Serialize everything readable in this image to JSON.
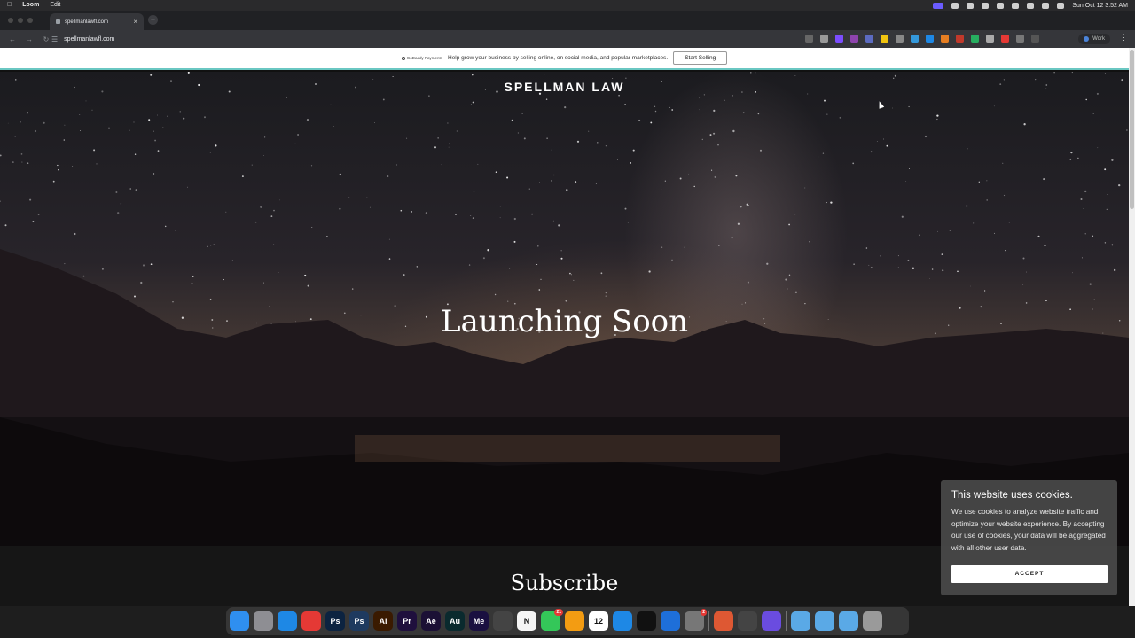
{
  "menubar": {
    "app": "Loom",
    "edit": "Edit",
    "clock": "Sun Oct 12  3:52 AM"
  },
  "browser": {
    "tab_title": "spellmanlawfl.com",
    "url": "spellmanlawfl.com",
    "profile": "Work"
  },
  "promo": {
    "brand": "GoDaddy Payments",
    "text": "Help grow your business by selling online, on social media, and popular marketplaces.",
    "button": "Start Selling"
  },
  "hero": {
    "site_title": "SPELLMAN LAW",
    "headline": "Launching Soon"
  },
  "subscribe": {
    "title": "Subscribe"
  },
  "cookie": {
    "title": "This website uses cookies.",
    "body": "We use cookies to analyze website traffic and optimize your website experience. By accepting our use of cookies, your data will be aggregated with all other user data.",
    "accept": "ACCEPT"
  },
  "dock": [
    {
      "name": "finder-icon",
      "label": "",
      "color": "#2f8ff0"
    },
    {
      "name": "launchpad-icon",
      "label": "",
      "color": "#8e8e93"
    },
    {
      "name": "safari-icon",
      "label": "",
      "color": "#1e88e5"
    },
    {
      "name": "chrome-icon",
      "label": "",
      "color": "#e53935"
    },
    {
      "name": "photoshop-icon",
      "label": "Ps",
      "color": "#0c2340"
    },
    {
      "name": "photoshop-beta-icon",
      "label": "Ps",
      "color": "#1e3a5f"
    },
    {
      "name": "illustrator-icon",
      "label": "Ai",
      "color": "#3a1a00"
    },
    {
      "name": "premiere-icon",
      "label": "Pr",
      "color": "#1f0f3d"
    },
    {
      "name": "after-effects-icon",
      "label": "Ae",
      "color": "#1b1035"
    },
    {
      "name": "audition-icon",
      "label": "Au",
      "color": "#0a2a2e"
    },
    {
      "name": "media-encoder-icon",
      "label": "Me",
      "color": "#1a1040"
    },
    {
      "name": "finalcut-icon",
      "label": "",
      "color": "#444"
    },
    {
      "name": "notion-icon",
      "label": "N",
      "color": "#f5f5f5"
    },
    {
      "name": "messages-icon",
      "label": "",
      "color": "#34c759",
      "badge": "21"
    },
    {
      "name": "photos-icon",
      "label": "",
      "color": "#f39c12"
    },
    {
      "name": "calendar-icon",
      "label": "12",
      "color": "#ffffff"
    },
    {
      "name": "app-store-icon",
      "label": "",
      "color": "#1e88e5"
    },
    {
      "name": "capcut-icon",
      "label": "",
      "color": "#111"
    },
    {
      "name": "vscode-icon",
      "label": "",
      "color": "#1e6fd9"
    },
    {
      "name": "system-settings-icon",
      "label": "",
      "color": "#777",
      "badge": "2"
    },
    {
      "name": "duckduckgo-icon",
      "label": "",
      "color": "#de5833"
    },
    {
      "name": "quicktime-icon",
      "label": "",
      "color": "#444"
    },
    {
      "name": "compressor-icon",
      "label": "",
      "color": "#6a4ce0"
    },
    {
      "name": "downloads-folder-icon",
      "label": "",
      "color": "#5aa9e6"
    },
    {
      "name": "applications-folder-icon",
      "label": "",
      "color": "#5aa9e6"
    },
    {
      "name": "screenshots-folder-icon",
      "label": "",
      "color": "#5aa9e6"
    },
    {
      "name": "trash-icon",
      "label": "",
      "color": "#9a9a9a"
    }
  ]
}
